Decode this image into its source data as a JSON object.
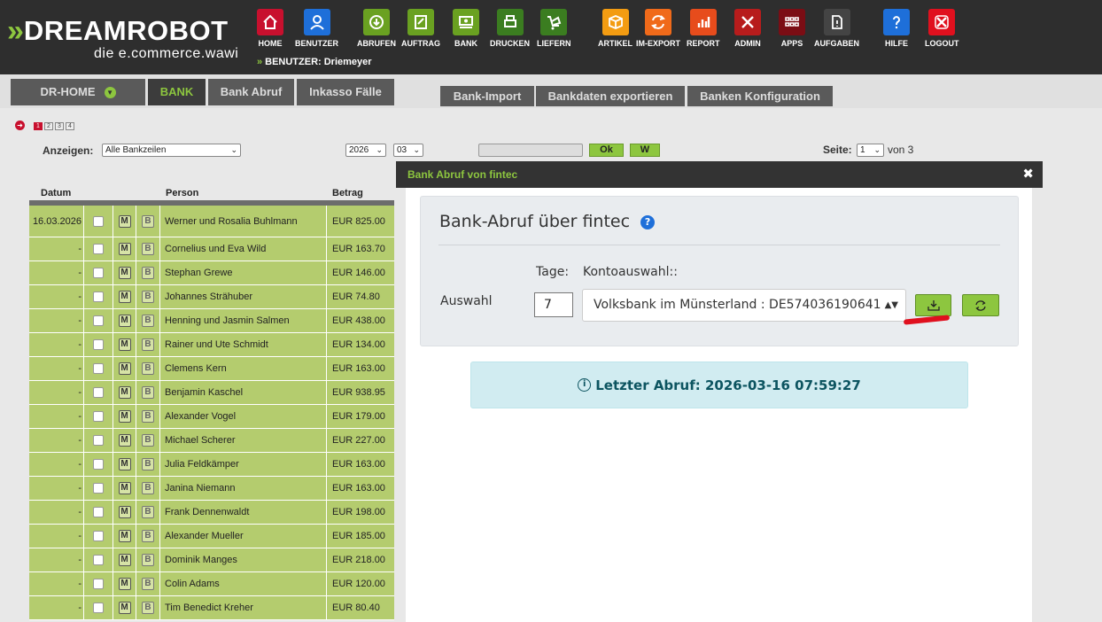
{
  "logo": {
    "prefix": "»",
    "name": "DREAMROBOT",
    "tagline": "die e.commerce.wawi"
  },
  "user": {
    "label": "BENUTZER: Driemeyer"
  },
  "nav": [
    {
      "label": "HOME",
      "icon": "home-icon",
      "color": "#c8102e"
    },
    {
      "label": "BENUTZER",
      "icon": "user-icon",
      "color": "#1e6fd9"
    },
    {
      "label": "ABRUFEN",
      "icon": "cloud-download-icon",
      "color": "#6aa121"
    },
    {
      "label": "AUFTRAG",
      "icon": "order-icon",
      "color": "#6aa121"
    },
    {
      "label": "BANK",
      "icon": "bank-icon",
      "color": "#6aa121"
    },
    {
      "label": "DRUCKEN",
      "icon": "print-icon",
      "color": "#3b7d20"
    },
    {
      "label": "LIEFERN",
      "icon": "delivery-icon",
      "color": "#3b7d20"
    },
    {
      "label": "ARTIKEL",
      "icon": "box-icon",
      "color": "#f39c12"
    },
    {
      "label": "IM-EXPORT",
      "icon": "sync-icon",
      "color": "#f06a1a"
    },
    {
      "label": "REPORT",
      "icon": "chart-icon",
      "color": "#e74c1c"
    },
    {
      "label": "ADMIN",
      "icon": "tools-icon",
      "color": "#b71c1c"
    },
    {
      "label": "APPS",
      "icon": "apps-icon",
      "color": "#7b0d14"
    },
    {
      "label": "AUFGABEN",
      "icon": "task-icon",
      "color": "#444444"
    },
    {
      "label": "HILFE",
      "icon": "help-icon",
      "color": "#1e6fd9"
    },
    {
      "label": "LOGOUT",
      "icon": "logout-icon",
      "color": "#e0101e"
    }
  ],
  "tabs": {
    "main": [
      "DR-HOME",
      "BANK",
      "Bank Abruf",
      "Inkasso Fälle"
    ],
    "sub": [
      "Bank-Import",
      "Bankdaten exportieren",
      "Banken Konfiguration"
    ]
  },
  "pages": [
    "1",
    "2",
    "3",
    "4"
  ],
  "filter": {
    "anzeigen_label": "Anzeigen:",
    "anzeigen_value": "Alle Bankzeilen",
    "year": "2026",
    "month": "03",
    "ok": "Ok",
    "w": "W",
    "seite_label": "Seite:",
    "seite_value": "1",
    "von": "von 3"
  },
  "table": {
    "headers": {
      "datum": "Datum",
      "person": "Person",
      "betrag": "Betrag"
    },
    "m_label": "M",
    "b_label": "B",
    "rows": [
      {
        "datum": "16.03.2026",
        "person": "Werner und Rosalia Buhlmann",
        "betrag": "EUR 825.00"
      },
      {
        "datum": "-",
        "person": "Cornelius und Eva Wild",
        "betrag": "EUR 163.70"
      },
      {
        "datum": "-",
        "person": "Stephan Grewe",
        "betrag": "EUR 146.00"
      },
      {
        "datum": "-",
        "person": "Johannes Strähuber",
        "betrag": "EUR 74.80"
      },
      {
        "datum": "-",
        "person": "Henning und Jasmin Salmen",
        "betrag": "EUR 438.00"
      },
      {
        "datum": "-",
        "person": "Rainer und Ute Schmidt",
        "betrag": "EUR 134.00"
      },
      {
        "datum": "-",
        "person": "Clemens Kern",
        "betrag": "EUR 163.00"
      },
      {
        "datum": "-",
        "person": "Benjamin Kaschel",
        "betrag": "EUR 938.95"
      },
      {
        "datum": "-",
        "person": "Alexander Vogel",
        "betrag": "EUR 179.00"
      },
      {
        "datum": "-",
        "person": "Michael Scherer",
        "betrag": "EUR 227.00"
      },
      {
        "datum": "-",
        "person": "Julia Feldkämper",
        "betrag": "EUR 163.00"
      },
      {
        "datum": "-",
        "person": "Janina Niemann",
        "betrag": "EUR 163.00"
      },
      {
        "datum": "-",
        "person": "Frank Dennenwaldt",
        "betrag": "EUR 198.00"
      },
      {
        "datum": "-",
        "person": "Alexander Mueller",
        "betrag": "EUR 185.00"
      },
      {
        "datum": "-",
        "person": "Dominik Manges",
        "betrag": "EUR 218.00"
      },
      {
        "datum": "-",
        "person": "Colin Adams",
        "betrag": "EUR 120.00"
      },
      {
        "datum": "-",
        "person": "Tim Benedict Kreher",
        "betrag": "EUR 80.40"
      }
    ]
  },
  "modal": {
    "title": "Bank Abruf von fintec",
    "close": "✖",
    "heading": "Bank-Abruf über fintec",
    "help": "?",
    "tage_label": "Tage:",
    "konto_label": "Kontoauswahl::",
    "auswahl_label": "Auswahl",
    "tage_value": "7",
    "konto_value": "Volksbank im Münsterland : DE574036190641",
    "info_icon": "i",
    "last_fetch": "Letzter Abruf: 2026-03-16 07:59:27"
  },
  "colors": {
    "accent": "#8dc63f",
    "header": "#2e2e2e",
    "row": "#b4cc6e",
    "info_bg": "#d1ecf1",
    "info_text": "#0c5460"
  }
}
